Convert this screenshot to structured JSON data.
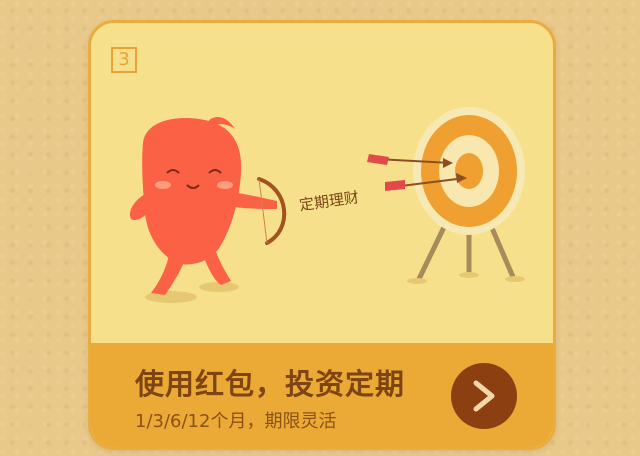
{
  "card": {
    "step_number": "3",
    "illustration_label": "定期理财",
    "title": "使用红包，投资定期",
    "subtitle": "1/3/6/12个月，期限灵活"
  },
  "colors": {
    "card_background": "#f7e08b",
    "accent_bar": "#eba936",
    "title_text": "#7e4512",
    "button": "#8c3f10",
    "character": "#fb6145"
  },
  "icons": {
    "next_button": "chevron-right-icon"
  }
}
